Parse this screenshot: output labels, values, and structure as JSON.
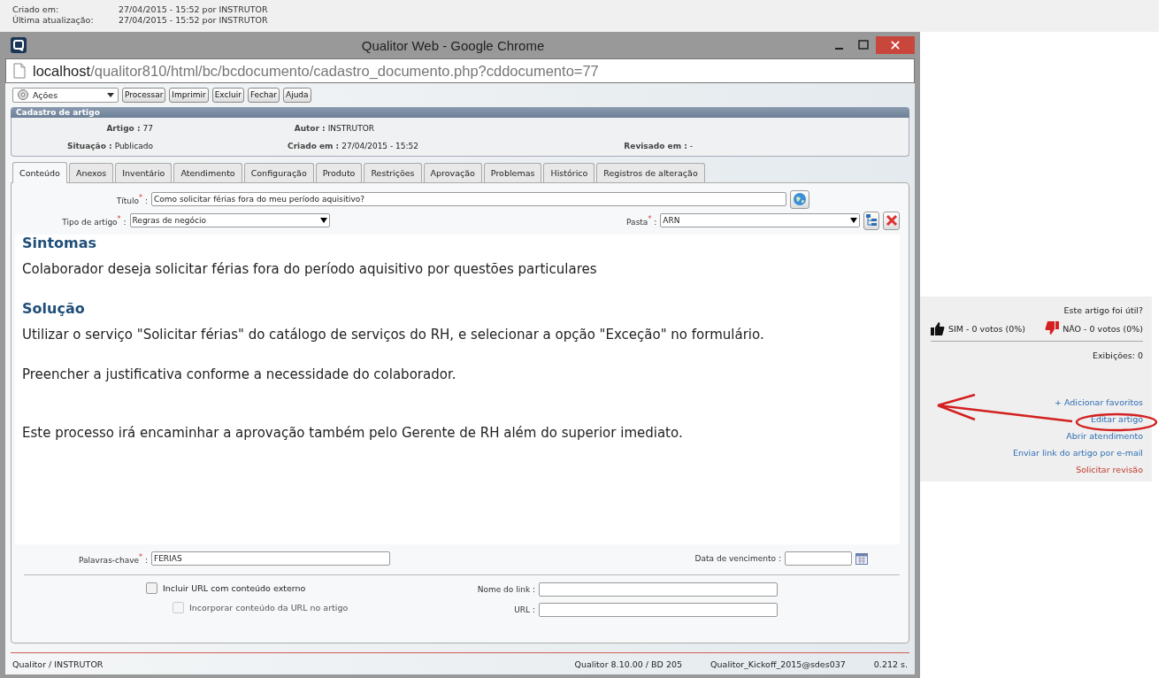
{
  "record_info": [
    {
      "label": "Criado em:",
      "value": "27/04/2015 - 15:52 por INSTRUTOR"
    },
    {
      "label": "Última atualização:",
      "value": "27/04/2015 - 15:52 por INSTRUTOR"
    }
  ],
  "window": {
    "title": "Qualitor Web - Google Chrome",
    "url_host": "localhost",
    "url_path": "/qualitor810/html/bc/bcdocumento/cadastro_documento.php?cddocumento=77"
  },
  "toolbar": {
    "actions_dropdown": "Ações",
    "buttons": [
      "Processar",
      "Imprimir",
      "Excluir",
      "Fechar",
      "Ajuda"
    ]
  },
  "panel": {
    "title": "Cadastro de artigo",
    "fields": [
      {
        "label": "Artigo :",
        "value": "77"
      },
      {
        "label": "Autor :",
        "value": "INSTRUTOR"
      },
      {
        "label": "Situação :",
        "value": "Publicado"
      },
      {
        "label": "Criado em :",
        "value": "27/04/2015 - 15:52"
      },
      {
        "label": "Revisado em :",
        "value": "-"
      }
    ]
  },
  "tabs": [
    {
      "label": "Conteúdo",
      "selected": true
    },
    {
      "label": "Anexos",
      "selected": false
    },
    {
      "label": "Inventário",
      "selected": false
    },
    {
      "label": "Atendimento",
      "selected": false
    },
    {
      "label": "Configuração",
      "selected": false
    },
    {
      "label": "Produto",
      "selected": false
    },
    {
      "label": "Restrições",
      "selected": false
    },
    {
      "label": "Aprovação",
      "selected": false
    },
    {
      "label": "Problemas",
      "selected": false
    },
    {
      "label": "Histórico",
      "selected": false
    },
    {
      "label": "Registros de alteração",
      "selected": false
    }
  ],
  "form": {
    "title_label": "Título$^{*}$ :",
    "title_value": "Como solicitar férias fora do meu período aquisitivo?",
    "type_label": "Tipo de artigo$^{*}$ :",
    "type_value": "Regras de negócio",
    "folder_label": "Pasta$^{*}$ :",
    "folder_value": "ARN"
  },
  "article": [
    {
      "kind": "heading",
      "text": "Sintomas"
    },
    {
      "kind": "paragraph",
      "text": "Colaborador deseja solicitar férias fora do período aquisitivo por questões particulares"
    },
    {
      "kind": "heading",
      "text": "Solução"
    },
    {
      "kind": "paragraph",
      "text": "Utilizar o serviço \"Solicitar férias\" do catálogo de serviços do RH, e selecionar a opção \"Exceção\" no formulário."
    },
    {
      "kind": "paragraph",
      "text": "Preencher a justificativa conforme a necessidade do colaborador."
    },
    {
      "kind": "spacer"
    },
    {
      "kind": "paragraph",
      "text": "Este processo irá encaminhar a aprovação também pelo Gerente de RH além do superior imediato."
    }
  ],
  "keywords": {
    "label": "Palavras-chave$^{*}$ :",
    "value": "FERIAS"
  },
  "due_date": {
    "label": "Data de vencimento :"
  },
  "checkboxes": [
    {
      "label": "Incluir URL com conteúdo externo",
      "checked": false,
      "disabled": false
    },
    {
      "label": "Incorporar conteúdo da URL no artigo",
      "checked": false,
      "disabled": true
    }
  ],
  "link_fields": [
    {
      "label": "Nome do link :"
    },
    {
      "label": "URL :"
    }
  ],
  "status_bar": {
    "user": "Qualitor / INSTRUTOR",
    "version": "Qualitor 8.10.00 / BD 205",
    "database": "Qualitor_Kickoff_2015@sdes037",
    "time": "0.212 s."
  },
  "side_panel": {
    "question": "Este artigo foi útil?",
    "yes": "SIM - 0 votos (0%)",
    "no": "NÃO - 0 votos (0%)",
    "views": "Exibições: 0",
    "links": [
      {
        "text": "+ Adicionar favoritos",
        "kind": "normal"
      },
      {
        "text": "Editar artigo",
        "kind": "normal"
      },
      {
        "text": "Abrir atendimento",
        "kind": "normal"
      },
      {
        "text": "Enviar link do artigo por e-mail",
        "kind": "normal"
      },
      {
        "text": "Solicitar revisão",
        "kind": "alert"
      }
    ]
  }
}
